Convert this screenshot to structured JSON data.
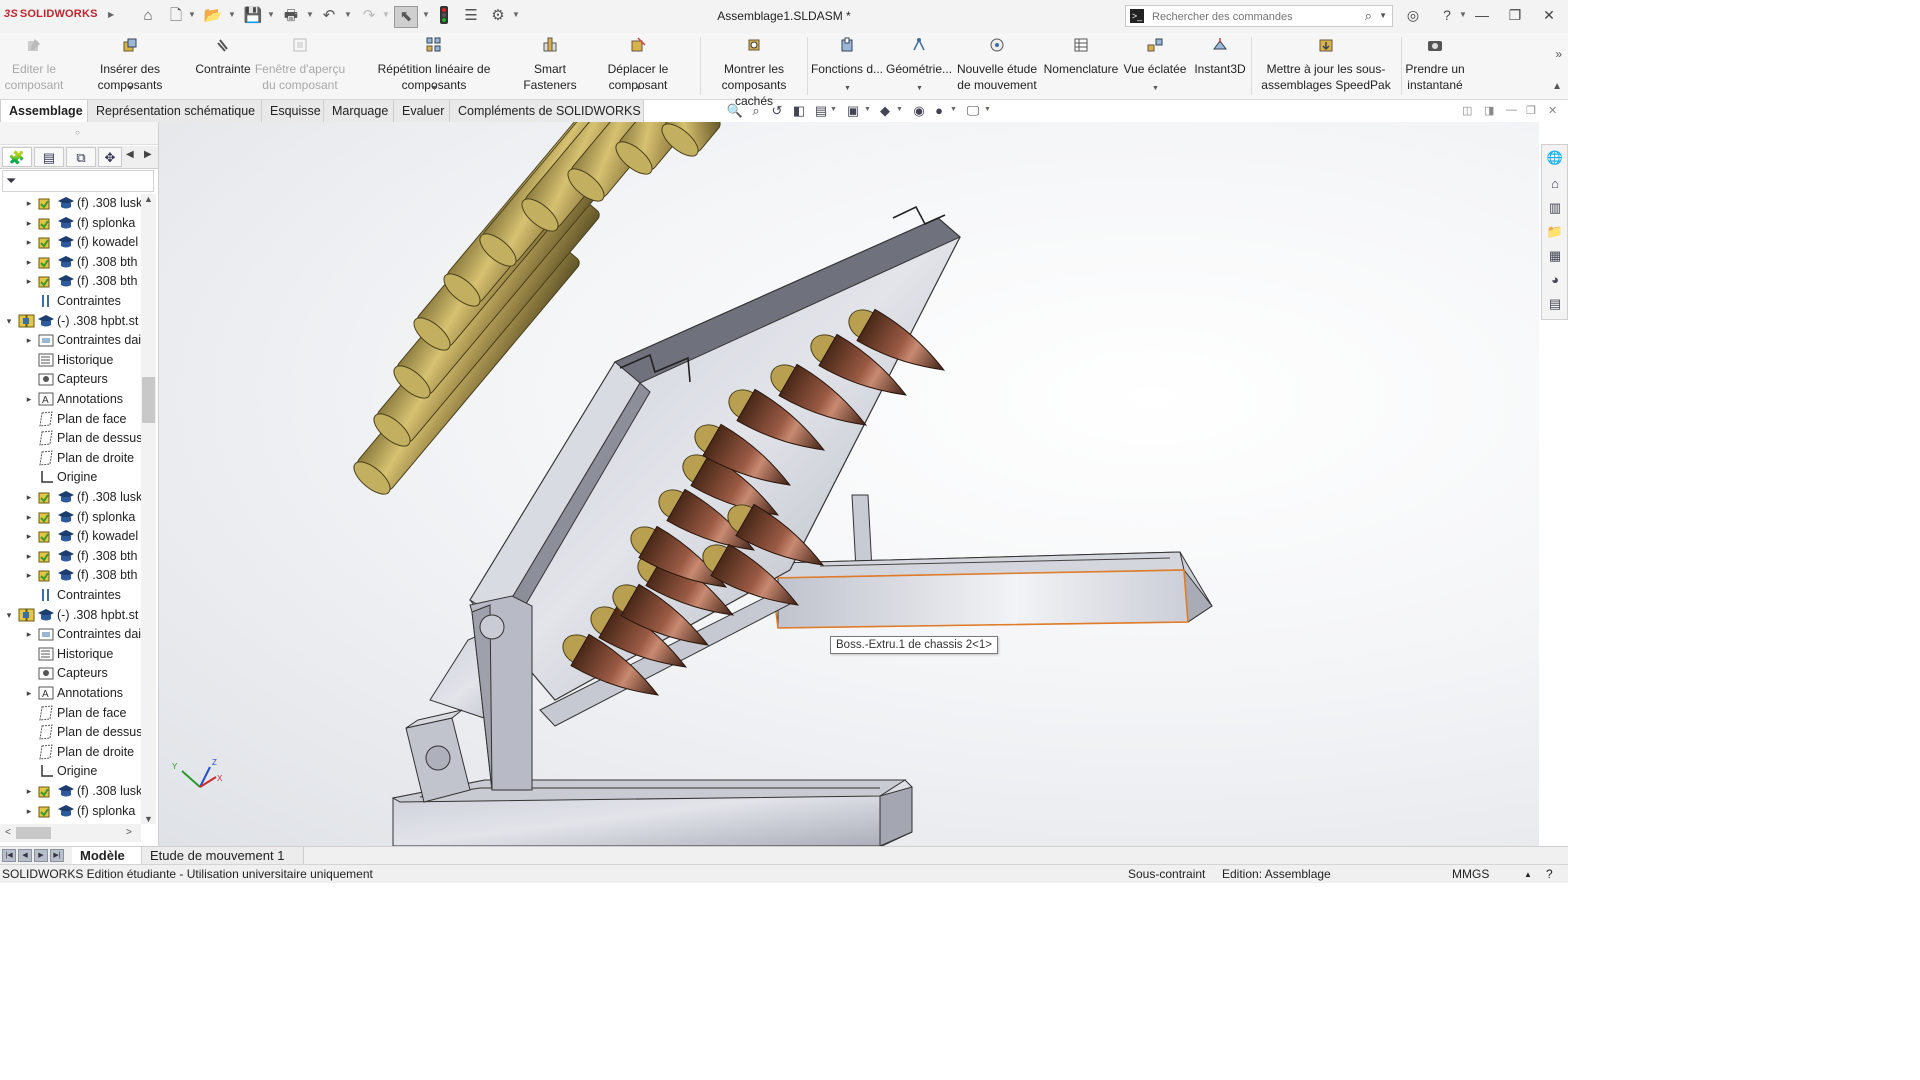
{
  "app": {
    "logo_text": "SOLIDWORKS",
    "document_title": "Assemblage1.SLDASM *",
    "accent_color": "#c0262d"
  },
  "title_toolbar": {
    "icons": [
      "home-icon",
      "new-document-icon",
      "open-icon",
      "save-icon",
      "print-icon",
      "undo-icon",
      "redo-icon",
      "select-pointer-icon",
      "traffic-light-icon",
      "file-properties-icon",
      "options-gear-icon"
    ]
  },
  "search": {
    "placeholder": "Rechercher des commandes"
  },
  "ribbon": {
    "buttons": [
      {
        "label": "Editer le composant",
        "enabled": false
      },
      {
        "label": "Insérer des composants",
        "enabled": true
      },
      {
        "label": "Contrainte",
        "enabled": true
      },
      {
        "label": "Fenêtre d'aperçu du composant",
        "enabled": false
      },
      {
        "label": "Répétition linéaire de composants",
        "enabled": true
      },
      {
        "label": "Smart Fasteners",
        "enabled": true
      },
      {
        "label": "Déplacer le composant",
        "enabled": true
      },
      {
        "label": "Montrer les composants cachés",
        "enabled": true
      },
      {
        "label": "Fonctions d...",
        "enabled": true
      },
      {
        "label": "Géométrie...",
        "enabled": true
      },
      {
        "label": "Nouvelle étude de mouvement",
        "enabled": true
      },
      {
        "label": "Nomenclature",
        "enabled": true
      },
      {
        "label": "Vue éclatée",
        "enabled": true
      },
      {
        "label": "Instant3D",
        "enabled": true
      },
      {
        "label": "Mettre à jour les sous-assemblages SpeedPak",
        "enabled": true
      },
      {
        "label": "Prendre un instantané",
        "enabled": true
      }
    ]
  },
  "tabs": [
    {
      "label": "Assemblage",
      "active": true
    },
    {
      "label": "Représentation schématique",
      "active": false
    },
    {
      "label": "Esquisse",
      "active": false
    },
    {
      "label": "Marquage",
      "active": false
    },
    {
      "label": "Evaluer",
      "active": false
    },
    {
      "label": "Compléments de SOLIDWORKS",
      "active": false
    }
  ],
  "tree": {
    "rows": [
      {
        "label": "(f) .308 lusk",
        "kind": "part",
        "expand": "collapsed"
      },
      {
        "label": "(f) splonka",
        "kind": "part",
        "expand": "collapsed"
      },
      {
        "label": "(f) kowadel",
        "kind": "part",
        "expand": "collapsed"
      },
      {
        "label": "(f) .308 bth",
        "kind": "part",
        "expand": "collapsed"
      },
      {
        "label": "(f) .308 bth",
        "kind": "part",
        "expand": "collapsed"
      },
      {
        "label": "Contraintes",
        "kind": "mates",
        "expand": "none"
      },
      {
        "label": "(-) .308 hpbt.st",
        "kind": "assembly",
        "expand": "expanded"
      },
      {
        "label": "Contraintes dai",
        "kind": "folder",
        "expand": "collapsed"
      },
      {
        "label": "Historique",
        "kind": "history",
        "expand": "none"
      },
      {
        "label": "Capteurs",
        "kind": "sensors",
        "expand": "none"
      },
      {
        "label": "Annotations",
        "kind": "annotations",
        "expand": "collapsed"
      },
      {
        "label": "Plan de face",
        "kind": "plane",
        "expand": "none"
      },
      {
        "label": "Plan de dessus",
        "kind": "plane",
        "expand": "none"
      },
      {
        "label": "Plan de droite",
        "kind": "plane",
        "expand": "none"
      },
      {
        "label": "Origine",
        "kind": "origin",
        "expand": "none"
      },
      {
        "label": "(f) .308 lusk",
        "kind": "part",
        "expand": "collapsed"
      },
      {
        "label": "(f) splonka",
        "kind": "part",
        "expand": "collapsed"
      },
      {
        "label": "(f) kowadel",
        "kind": "part",
        "expand": "collapsed"
      },
      {
        "label": "(f) .308 bth",
        "kind": "part",
        "expand": "collapsed"
      },
      {
        "label": "(f) .308 bth",
        "kind": "part",
        "expand": "collapsed"
      },
      {
        "label": "Contraintes",
        "kind": "mates",
        "expand": "none"
      },
      {
        "label": "(-) .308 hpbt.st",
        "kind": "assembly",
        "expand": "expanded"
      },
      {
        "label": "Contraintes dai",
        "kind": "folder",
        "expand": "collapsed"
      },
      {
        "label": "Historique",
        "kind": "history",
        "expand": "none"
      },
      {
        "label": "Capteurs",
        "kind": "sensors",
        "expand": "none"
      },
      {
        "label": "Annotations",
        "kind": "annotations",
        "expand": "collapsed"
      },
      {
        "label": "Plan de face",
        "kind": "plane",
        "expand": "none"
      },
      {
        "label": "Plan de dessus",
        "kind": "plane",
        "expand": "none"
      },
      {
        "label": "Plan de droite",
        "kind": "plane",
        "expand": "none"
      },
      {
        "label": "Origine",
        "kind": "origin",
        "expand": "none"
      },
      {
        "label": "(f) .308 lusk",
        "kind": "part",
        "expand": "collapsed"
      },
      {
        "label": "(f) splonka",
        "kind": "part",
        "expand": "collapsed"
      }
    ]
  },
  "viewport": {
    "tooltip": "Boss.-Extru.1 de chassis 2<1>",
    "triad_labels": {
      "x": "X",
      "y": "Y",
      "z": "Z"
    }
  },
  "bottom_tabs": [
    {
      "label": "Modèle",
      "active": true
    },
    {
      "label": "Etude de mouvement 1",
      "active": false
    }
  ],
  "status": {
    "left": "SOLIDWORKS Edition étudiante - Utilisation universitaire uniquement",
    "constraint": "Sous-contraint",
    "mode": "Edition: Assemblage",
    "units": "MMGS"
  }
}
